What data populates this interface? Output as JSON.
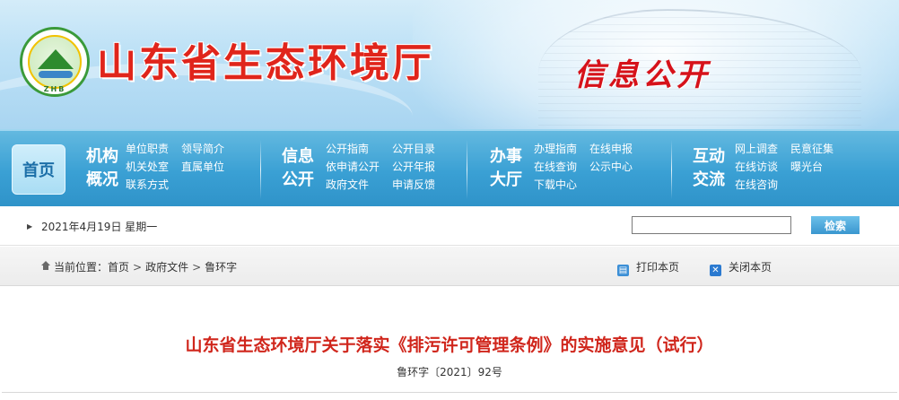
{
  "banner": {
    "logo_text": "ZHB",
    "site_title": "山东省生态环境厅",
    "section_title": "信息公开"
  },
  "nav": {
    "home": "首页",
    "groups": [
      {
        "title": "机构概况",
        "links": [
          "单位职责",
          "领导简介",
          "机关处室",
          "直属单位",
          "联系方式"
        ]
      },
      {
        "title": "信息公开",
        "links": [
          "公开指南",
          "公开目录",
          "依申请公开",
          "公开年报",
          "政府文件",
          "申请反馈"
        ]
      },
      {
        "title": "办事大厅",
        "links": [
          "办理指南",
          "在线申报",
          "在线查询",
          "公示中心",
          "下载中心"
        ]
      },
      {
        "title": "互动交流",
        "links": [
          "网上调查",
          "民意征集",
          "在线访谈",
          "曝光台",
          "在线咨询"
        ]
      }
    ]
  },
  "datebar": {
    "date": "2021年4月19日 星期一",
    "search_value": "",
    "search_button": "检索"
  },
  "breadcrumb": {
    "prefix": "当前位置：",
    "items": [
      "首页",
      "政府文件",
      "鲁环字"
    ],
    "print": "打印本页",
    "close": "关闭本页"
  },
  "article": {
    "title": "山东省生态环境厅关于落实《排污许可管理条例》的实施意见（试行）",
    "doc_no": "鲁环字〔2021〕92号"
  },
  "colors": {
    "title_red": "#e0251b",
    "nav_blue": "#3aa0d4",
    "article_title_red": "#d0261c"
  }
}
